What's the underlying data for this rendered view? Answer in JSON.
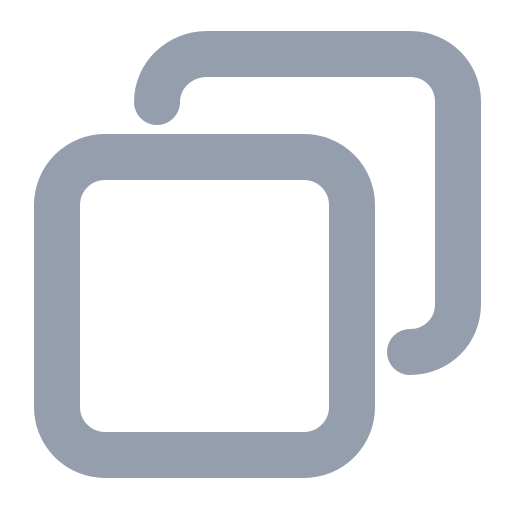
{
  "icon": {
    "name": "copy-icon",
    "color": "#949EAC",
    "background": "#FFFFFF"
  }
}
